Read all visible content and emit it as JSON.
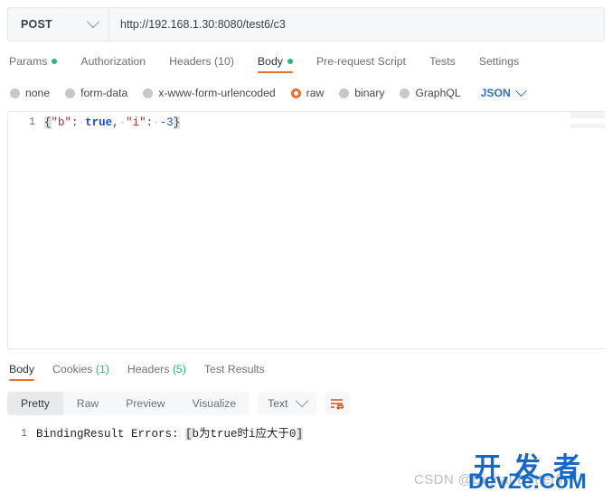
{
  "request": {
    "method": "POST",
    "url": "http://192.168.1.30:8080/test6/c3",
    "tabs": [
      {
        "label": "Params",
        "dot": true,
        "active": false
      },
      {
        "label": "Authorization",
        "dot": false,
        "active": false
      },
      {
        "label": "Headers (10)",
        "dot": false,
        "active": false
      },
      {
        "label": "Body",
        "dot": true,
        "active": true
      },
      {
        "label": "Pre-request Script",
        "dot": false,
        "active": false
      },
      {
        "label": "Tests",
        "dot": false,
        "active": false
      },
      {
        "label": "Settings",
        "dot": false,
        "active": false
      }
    ],
    "body_types": [
      {
        "label": "none",
        "selected": false
      },
      {
        "label": "form-data",
        "selected": false
      },
      {
        "label": "x-www-form-urlencoded",
        "selected": false
      },
      {
        "label": "raw",
        "selected": true
      },
      {
        "label": "binary",
        "selected": false
      },
      {
        "label": "GraphQL",
        "selected": false
      }
    ],
    "format": "JSON",
    "editor": {
      "line_number": "1",
      "raw": "{\"b\": true, \"i\": -3}",
      "tokens": [
        {
          "t": "{",
          "c": "tok-brace-hl"
        },
        {
          "t": "\"b\"",
          "c": "tok-key"
        },
        {
          "t": ":",
          "c": "tok-punct"
        },
        {
          "t": "·",
          "c": "tok-space"
        },
        {
          "t": "true",
          "c": "tok-bool"
        },
        {
          "t": ",",
          "c": "tok-punct"
        },
        {
          "t": "·",
          "c": "tok-space"
        },
        {
          "t": "\"i\"",
          "c": "tok-key"
        },
        {
          "t": ":",
          "c": "tok-punct"
        },
        {
          "t": "·",
          "c": "tok-space"
        },
        {
          "t": "-3",
          "c": "tok-num"
        },
        {
          "t": "}",
          "c": "tok-brace-hl"
        }
      ]
    }
  },
  "response": {
    "tabs": [
      {
        "label": "Body",
        "count": "",
        "active": true
      },
      {
        "label": "Cookies",
        "count": "(1)",
        "active": false
      },
      {
        "label": "Headers",
        "count": "(5)",
        "active": false
      },
      {
        "label": "Test Results",
        "count": "",
        "active": false
      }
    ],
    "view_modes": [
      {
        "label": "Pretty",
        "active": true
      },
      {
        "label": "Raw",
        "active": false
      },
      {
        "label": "Preview",
        "active": false
      },
      {
        "label": "Visualize",
        "active": false
      }
    ],
    "format": "Text",
    "body": {
      "line_number": "1",
      "raw": "BindingResult Errors: [b为true时i应大于0]",
      "tokens": [
        {
          "t": "BindingResult Errors: ",
          "c": "tok-res-text"
        },
        {
          "t": "[",
          "c": "tok-bracket-hl"
        },
        {
          "t": "b为true时i应大于0",
          "c": "tok-res-text"
        },
        {
          "t": "]",
          "c": "tok-bracket-hl"
        }
      ]
    }
  },
  "watermark": {
    "csdn": "CSDN @Digital-Butterfly",
    "chinese": "开发者",
    "site": "DevZe.CoM"
  },
  "colors": {
    "accent": "#ef6c33",
    "green": "#2bb673",
    "blue": "#2f6fd0",
    "watermark_blue": "#1667c8"
  }
}
